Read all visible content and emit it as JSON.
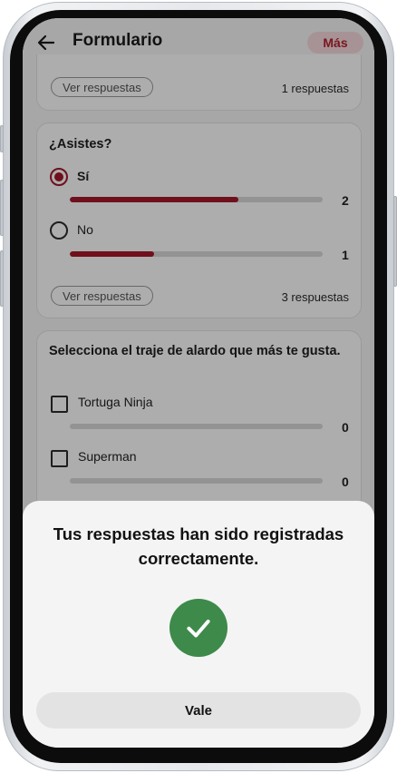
{
  "header": {
    "title": "Formulario",
    "more_label": "Más"
  },
  "card_prev": {
    "view_responses_label": "Ver respuestas",
    "responses_count": "1 respuestas"
  },
  "card_asistes": {
    "question": "¿Asistes?",
    "options": [
      {
        "label": "Sí",
        "selected": true,
        "count": "2",
        "fraction": 0.67
      },
      {
        "label": "No",
        "selected": false,
        "count": "1",
        "fraction": 0.33
      }
    ],
    "view_responses_label": "Ver respuestas",
    "responses_count": "3 respuestas"
  },
  "card_traje": {
    "question": "Selecciona el traje de alardo que más te gusta.",
    "options": [
      {
        "label": "Tortuga Ninja",
        "count": "0",
        "fraction": 0
      },
      {
        "label": "Superman",
        "count": "0",
        "fraction": 0
      }
    ]
  },
  "dialog": {
    "message": "Tus respuestas han sido registradas correctamente.",
    "confirm_label": "Vale",
    "icon": "check-icon",
    "success_color": "#3d8a4a"
  },
  "colors": {
    "accent": "#a4192a",
    "more_bg": "#f7d9de"
  }
}
